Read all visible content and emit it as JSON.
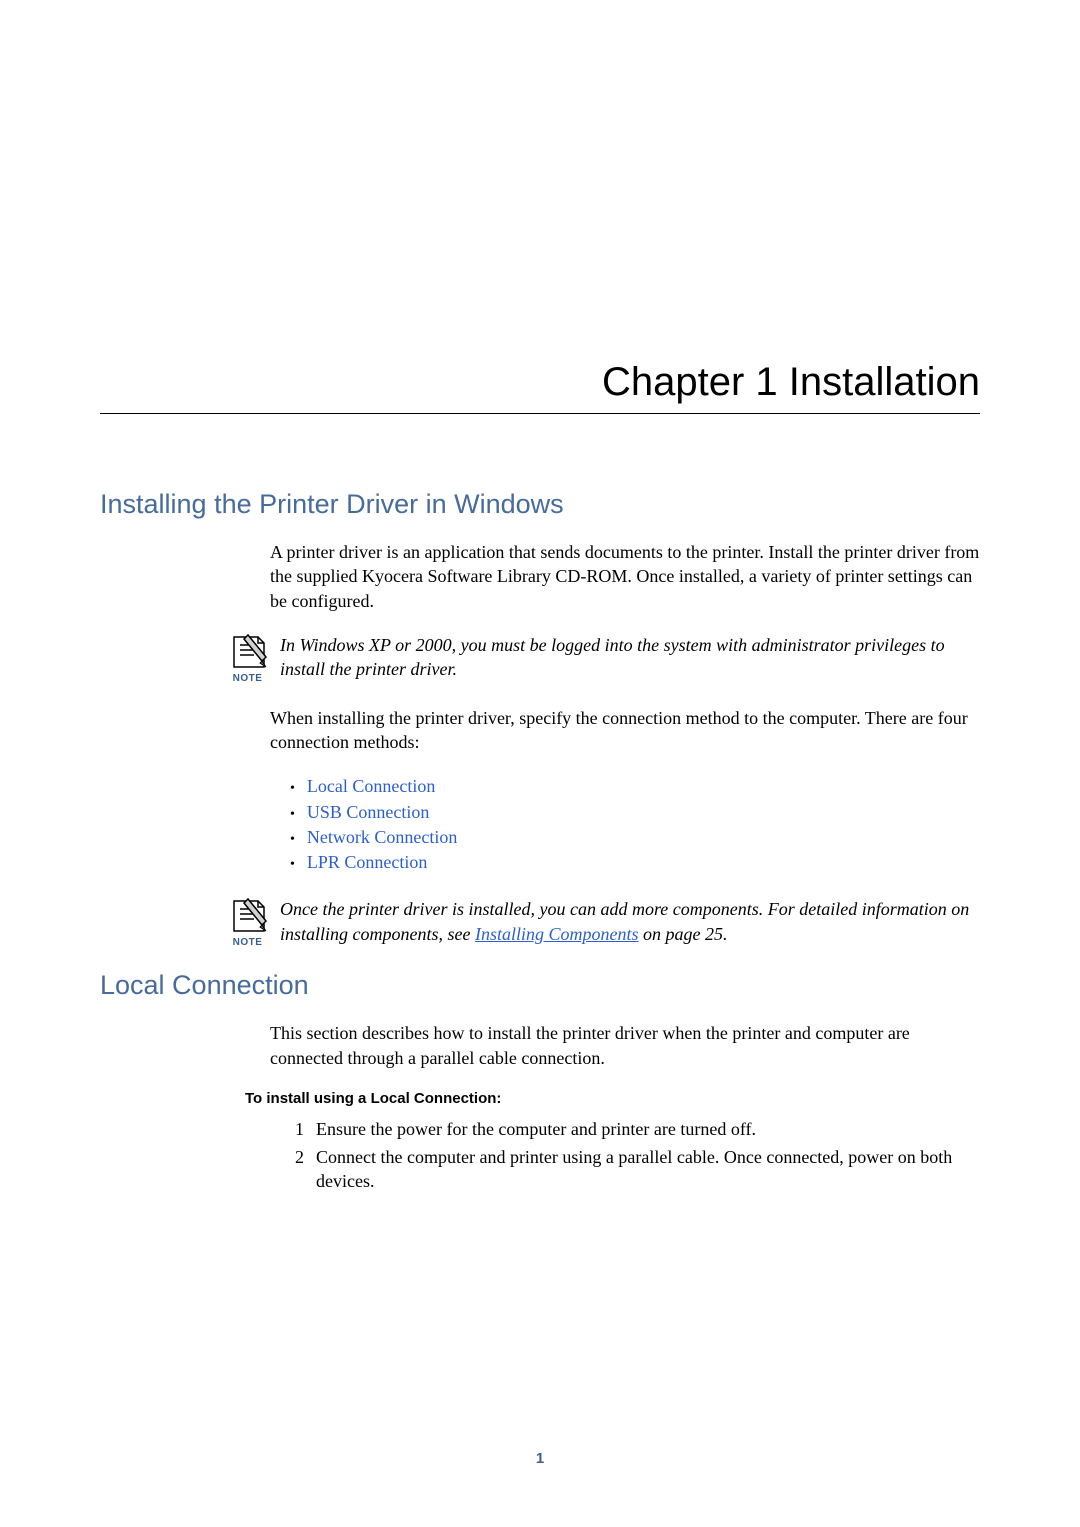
{
  "chapter": {
    "title": "Chapter 1  Installation"
  },
  "section1": {
    "title": "Installing the Printer Driver in Windows",
    "intro": "A printer driver is an application that sends documents to the printer. Install the printer driver from the supplied Kyocera Software Library CD-ROM. Once installed, a variety of printer settings can be configured."
  },
  "note1": {
    "label": "NOTE",
    "text": "In Windows XP or 2000, you must be logged into the system with administrator privileges to install the printer driver."
  },
  "body2": "When installing the printer driver, specify the connection method to the computer. There are four connection methods:",
  "bullets": {
    "b1": "Local Connection",
    "b2": "USB Connection",
    "b3": "Network Connection",
    "b4": "LPR Connection"
  },
  "note2": {
    "label": "NOTE",
    "text_pre": "Once the printer driver is installed, you can add more components. For detailed information on installing components, see ",
    "link": "Installing Components",
    "text_post": " on page 25."
  },
  "section2": {
    "title": "Local Connection",
    "intro": "This section describes how to install the printer driver when the printer and computer are connected through a parallel cable connection.",
    "proc_heading": "To install using a Local Connection:",
    "steps": {
      "s1": "Ensure the power for the computer and printer are turned off.",
      "s2": "Connect the computer and printer using a parallel cable. Once connected, power on both devices."
    }
  },
  "page_number": "1"
}
